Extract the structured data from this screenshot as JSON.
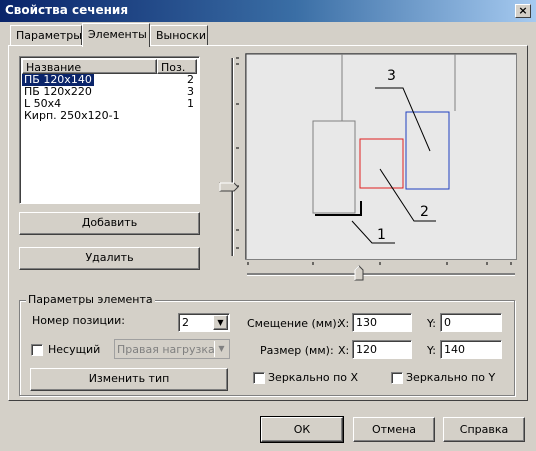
{
  "window": {
    "title": "Свойства сечения",
    "close": "×"
  },
  "tabs": [
    {
      "label": "Параметры"
    },
    {
      "label": "Элементы"
    },
    {
      "label": "Выноски"
    }
  ],
  "list": {
    "header_name": "Название",
    "header_pos": "Поз.",
    "rows": [
      {
        "name": "ПБ 120х140",
        "pos": "2",
        "selected": true
      },
      {
        "name": "ПБ 120х220",
        "pos": "3"
      },
      {
        "name": "L 50х4",
        "pos": "1"
      },
      {
        "name": "Кирп. 250х120-1",
        "pos": ""
      }
    ]
  },
  "buttons": {
    "add": "Добавить",
    "delete": "Удалить",
    "change_type": "Изменить тип",
    "ok": "ОК",
    "cancel": "Отмена",
    "help": "Справка"
  },
  "preview": {
    "callouts": [
      "1",
      "2",
      "3"
    ],
    "colors": {
      "red": "#e02020",
      "blue": "#2040c0",
      "gray": "#808080"
    }
  },
  "params": {
    "group_title": "Параметры элемента",
    "position_label": "Номер позиции:",
    "position_value": "2",
    "bearing_label": "Несущий",
    "load_value": "Правая нагрузка",
    "offset_label": "Смещение (мм):",
    "offset_x_label": "X:",
    "offset_x": "130",
    "offset_y_label": "Y:",
    "offset_y": "0",
    "size_label": "Размер (мм):",
    "size_x_label": "X:",
    "size_x": "120",
    "size_y_label": "Y:",
    "size_y": "140",
    "mirror_x": "Зеркально по X",
    "mirror_y": "Зеркально по Y"
  }
}
